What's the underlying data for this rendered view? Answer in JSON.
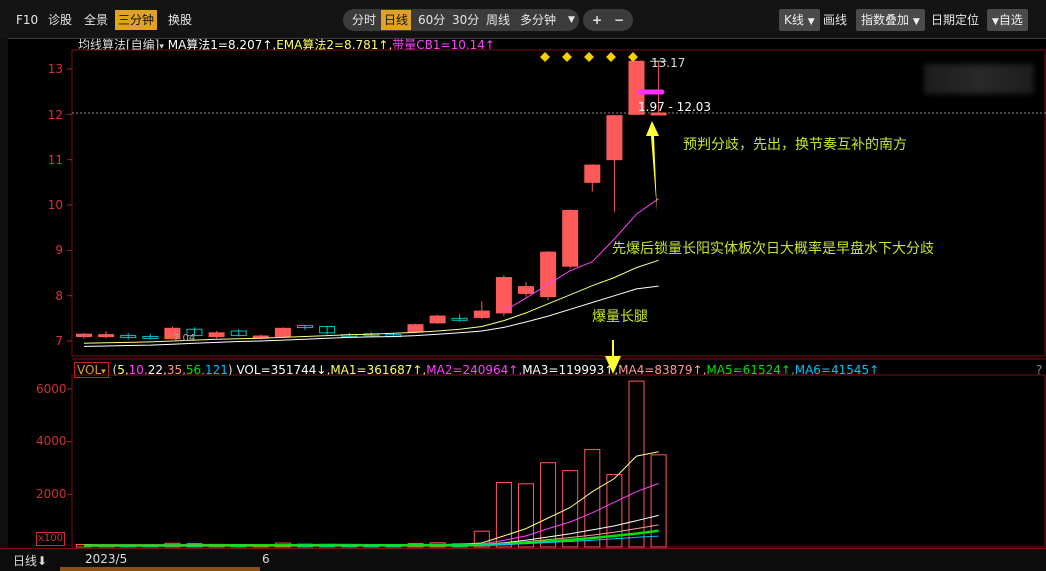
{
  "toolbar": {
    "f10": "F10",
    "zhengu": "诊股",
    "quanjing": "全景",
    "sanfenzhong": "三分钟",
    "huangu": "换股",
    "fenshi": "分时",
    "rixian": "日线",
    "m60": "60分",
    "m30": "30分",
    "zhouxian": "周线",
    "duofenzhong": "多分钟",
    "plus": "+",
    "minus": "−",
    "kxian": "K线",
    "huaxian": "画线",
    "zhibiao": "指数叠加",
    "riqi": "日期定位",
    "zixuan": "自选"
  },
  "price_header": {
    "indicator": "均线算法[自编]",
    "ma1": "MA算法1=8.207↑,",
    "ema2": "EMA算法2=8.781↑,",
    "cb1": "带量CB1=10.14↑"
  },
  "vol_header": {
    "vol_btn": "VOL",
    "params_open": "(",
    "p5": "5,",
    "p10": "10,",
    "p22": "22,",
    "p35": "35,",
    "p56": "56,",
    "p121": "121",
    "params_close": ")",
    "vol": "VOL=351744↓,",
    "ma1": "MA1=361687↑,",
    "ma2": "MA2=240964↑,",
    "ma3": "MA3=119993↑,",
    "ma4": "MA4=83879↑,",
    "ma5": "MA5=61524↑,",
    "ma6": "MA6=41545↑",
    "help": "?"
  },
  "price_axis": [
    "13",
    "12",
    "11",
    "10",
    "9",
    "8",
    "7"
  ],
  "vol_axis": [
    "6000",
    "4000",
    "2000"
  ],
  "vol_unit": "x100",
  "labels": {
    "high": "13.17",
    "range": "1.97 - 12.03",
    "low": "7.04"
  },
  "annotations": {
    "a1": "预判分歧，先出，换节奏互补的南方",
    "a2": "先爆后锁量长阳实体板次日大概率是早盘水下大分歧",
    "a3": "爆量长腿"
  },
  "bottom": {
    "period": "日线",
    "date1": "2023/5",
    "date2": "6"
  },
  "colors": {
    "up": "#ff5a5a",
    "down": "#00c0c0",
    "annotation": "#c8e62e",
    "arrow": "#ffff33",
    "marker": "#f0d000",
    "magenta": "#ff30ff"
  },
  "chart_data": {
    "type": "candlestick",
    "title": "",
    "price_ylim": [
      6.9,
      13.3
    ],
    "volume_ylim": [
      0,
      6500
    ],
    "candles": [
      {
        "o": 7.1,
        "h": 7.18,
        "l": 7.05,
        "c": 7.15,
        "v": 95,
        "up": true
      },
      {
        "o": 7.12,
        "h": 7.22,
        "l": 7.06,
        "c": 7.14,
        "v": 80,
        "up": true
      },
      {
        "o": 7.12,
        "h": 7.18,
        "l": 7.04,
        "c": 7.1,
        "v": 70,
        "up": false
      },
      {
        "o": 7.1,
        "h": 7.16,
        "l": 7.04,
        "c": 7.08,
        "v": 60,
        "up": false
      },
      {
        "o": 7.05,
        "h": 7.32,
        "l": 7.04,
        "c": 7.28,
        "v": 140,
        "up": true
      },
      {
        "o": 7.26,
        "h": 7.3,
        "l": 7.1,
        "c": 7.12,
        "v": 130,
        "up": false
      },
      {
        "o": 7.1,
        "h": 7.22,
        "l": 7.06,
        "c": 7.18,
        "v": 100,
        "up": true
      },
      {
        "o": 7.22,
        "h": 7.26,
        "l": 7.1,
        "c": 7.12,
        "v": 90,
        "up": false
      },
      {
        "o": 7.08,
        "h": 7.14,
        "l": 7.04,
        "c": 7.11,
        "v": 70,
        "up": true
      },
      {
        "o": 7.1,
        "h": 7.3,
        "l": 7.08,
        "c": 7.28,
        "v": 150,
        "up": true
      },
      {
        "o": 7.3,
        "h": 7.36,
        "l": 7.24,
        "c": 7.34,
        "v": 110,
        "up": false
      },
      {
        "o": 7.32,
        "h": 7.34,
        "l": 7.14,
        "c": 7.18,
        "v": 100,
        "up": false
      },
      {
        "o": 7.14,
        "h": 7.18,
        "l": 7.08,
        "c": 7.13,
        "v": 80,
        "up": false
      },
      {
        "o": 7.12,
        "h": 7.2,
        "l": 7.08,
        "c": 7.16,
        "v": 75,
        "up": false
      },
      {
        "o": 7.14,
        "h": 7.18,
        "l": 7.1,
        "c": 7.12,
        "v": 70,
        "up": false
      },
      {
        "o": 7.2,
        "h": 7.38,
        "l": 7.18,
        "c": 7.36,
        "v": 130,
        "up": true
      },
      {
        "o": 7.4,
        "h": 7.58,
        "l": 7.38,
        "c": 7.55,
        "v": 160,
        "up": true
      },
      {
        "o": 7.48,
        "h": 7.6,
        "l": 7.42,
        "c": 7.5,
        "v": 120,
        "up": false
      },
      {
        "o": 7.52,
        "h": 7.88,
        "l": 7.48,
        "c": 7.66,
        "v": 600,
        "up": true
      },
      {
        "o": 7.62,
        "h": 8.45,
        "l": 7.55,
        "c": 8.4,
        "v": 2450,
        "up": true
      },
      {
        "o": 8.05,
        "h": 8.3,
        "l": 7.98,
        "c": 8.2,
        "v": 2400,
        "up": true
      },
      {
        "o": 7.98,
        "h": 8.98,
        "l": 7.9,
        "c": 8.96,
        "v": 3200,
        "up": true
      },
      {
        "o": 8.65,
        "h": 9.9,
        "l": 8.6,
        "c": 9.88,
        "v": 2900,
        "up": true
      },
      {
        "o": 10.5,
        "h": 10.9,
        "l": 10.3,
        "c": 10.88,
        "v": 3700,
        "up": true
      },
      {
        "o": 11.0,
        "h": 11.99,
        "l": 9.85,
        "c": 11.97,
        "v": 2750,
        "up": true
      },
      {
        "o": 12.0,
        "h": 13.17,
        "l": 12.0,
        "c": 13.17,
        "v": 6300,
        "up": true
      },
      {
        "o": 12.03,
        "h": 13.17,
        "l": 12.0,
        "c": 12.03,
        "v": 3500,
        "up": true
      }
    ],
    "ma_lines": [
      {
        "name": "MA1",
        "color": "#ffffff",
        "values": [
          6.88,
          6.89,
          6.9,
          6.91,
          6.93,
          6.95,
          6.97,
          6.99,
          7.0,
          7.02,
          7.04,
          7.06,
          7.08,
          7.09,
          7.1,
          7.12,
          7.15,
          7.18,
          7.22,
          7.3,
          7.42,
          7.55,
          7.7,
          7.85,
          8.0,
          8.15,
          8.21
        ]
      },
      {
        "name": "MA2",
        "color": "#ffff80",
        "values": [
          6.95,
          6.96,
          6.97,
          6.98,
          7.0,
          7.02,
          7.04,
          7.05,
          7.06,
          7.08,
          7.1,
          7.12,
          7.14,
          7.15,
          7.17,
          7.19,
          7.22,
          7.26,
          7.32,
          7.45,
          7.62,
          7.82,
          8.02,
          8.22,
          8.4,
          8.62,
          8.78
        ]
      },
      {
        "name": "CB1",
        "color": "#ff40ff",
        "values": [
          null,
          null,
          null,
          null,
          null,
          null,
          null,
          null,
          null,
          null,
          null,
          null,
          null,
          null,
          null,
          null,
          null,
          null,
          null,
          7.66,
          7.95,
          8.25,
          8.55,
          8.75,
          9.25,
          9.8,
          10.14
        ]
      }
    ],
    "vol_ma_lines": [
      {
        "name": "MA1",
        "color": "#ffff80",
        "values": [
          90,
          88,
          86,
          84,
          88,
          90,
          92,
          94,
          94,
          96,
          96,
          98,
          98,
          96,
          95,
          96,
          100,
          105,
          150,
          420,
          700,
          1100,
          1500,
          2100,
          2600,
          3450,
          3617
        ]
      },
      {
        "name": "MA2",
        "color": "#ff40ff",
        "values": [
          80,
          80,
          80,
          80,
          82,
          84,
          86,
          88,
          90,
          90,
          92,
          92,
          92,
          92,
          92,
          93,
          95,
          98,
          110,
          250,
          420,
          700,
          950,
          1300,
          1700,
          2100,
          2410
        ]
      },
      {
        "name": "MA3",
        "color": "#ffffff",
        "values": [
          70,
          70,
          70,
          70,
          72,
          74,
          76,
          78,
          80,
          80,
          82,
          82,
          82,
          82,
          82,
          83,
          84,
          86,
          95,
          160,
          260,
          380,
          500,
          650,
          800,
          1000,
          1200
        ]
      },
      {
        "name": "MA4",
        "color": "#ff9999",
        "values": [
          60,
          60,
          60,
          60,
          62,
          64,
          66,
          68,
          70,
          70,
          72,
          72,
          72,
          72,
          72,
          73,
          74,
          76,
          82,
          130,
          200,
          280,
          360,
          450,
          560,
          700,
          839
        ]
      },
      {
        "name": "MA5",
        "color": "#00e000",
        "values": [
          55,
          55,
          55,
          55,
          57,
          58,
          60,
          62,
          64,
          64,
          66,
          66,
          66,
          66,
          66,
          67,
          68,
          70,
          75,
          110,
          160,
          210,
          270,
          340,
          420,
          510,
          615
        ]
      },
      {
        "name": "MA6",
        "color": "#00c0ff",
        "values": [
          50,
          50,
          50,
          50,
          52,
          53,
          55,
          57,
          58,
          58,
          60,
          60,
          60,
          60,
          60,
          61,
          62,
          64,
          68,
          95,
          130,
          170,
          210,
          260,
          310,
          370,
          415
        ]
      }
    ]
  }
}
